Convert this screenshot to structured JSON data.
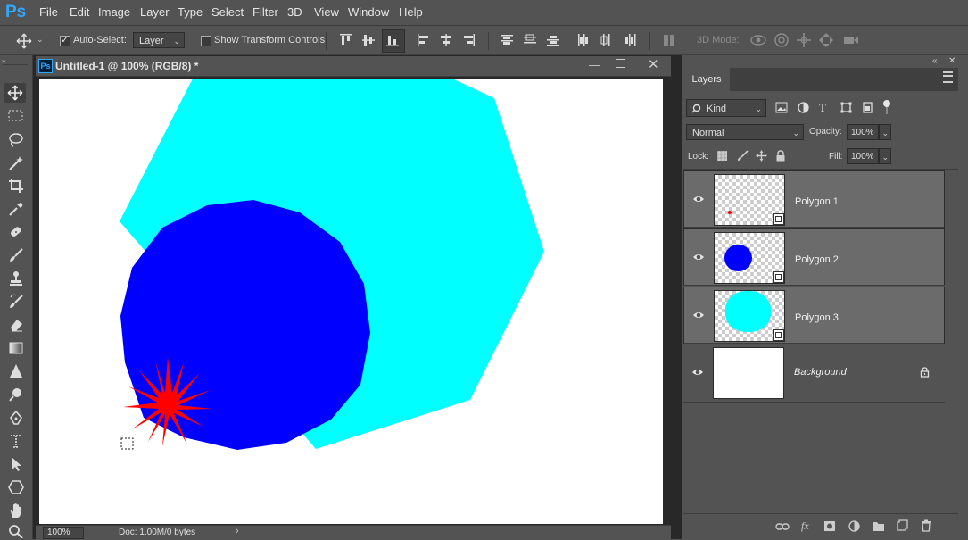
{
  "app": {
    "logo": "Ps"
  },
  "menu": [
    "File",
    "Edit",
    "Image",
    "Layer",
    "Type",
    "Select",
    "Filter",
    "3D",
    "View",
    "Window",
    "Help"
  ],
  "options": {
    "auto_select_label": "Auto-Select:",
    "auto_select_checked": true,
    "auto_select_target": "Layer",
    "transform_label": "Show Transform Controls",
    "transform_checked": false,
    "mode_3d_label": "3D Mode:"
  },
  "tools": [
    "move-tool-icon",
    "rectangular-marquee-icon",
    "lasso-icon",
    "magic-wand-icon",
    "crop-icon",
    "eyedropper-icon",
    "healing-brush-icon",
    "brush-icon",
    "clone-stamp-icon",
    "history-brush-icon",
    "eraser-icon",
    "gradient-icon",
    "blur-icon",
    "dodge-icon",
    "pen-icon",
    "type-icon",
    "path-selection-icon",
    "shape-icon",
    "hand-icon",
    "zoom-icon"
  ],
  "document": {
    "title": "Untitled-1 @ 100% (RGB/8) *",
    "zoom": "100%",
    "doc_info": "Doc: 1.00M/0 bytes",
    "colors": {
      "cyan": "#00ffff",
      "blue": "#0000ff",
      "red": "#ff0000"
    }
  },
  "layers_panel": {
    "tab": "Layers",
    "filter_kind": "Kind",
    "blend_mode": "Normal",
    "opacity_label": "Opacity:",
    "opacity": "100%",
    "lock_label": "Lock:",
    "fill_label": "Fill:",
    "fill": "100%",
    "layers": [
      {
        "name": "Polygon 1",
        "visible": true,
        "selected": true
      },
      {
        "name": "Polygon 2",
        "visible": true,
        "selected": true
      },
      {
        "name": "Polygon 3",
        "visible": true,
        "selected": true
      },
      {
        "name": "Background",
        "visible": true,
        "selected": false,
        "locked": true
      }
    ]
  }
}
